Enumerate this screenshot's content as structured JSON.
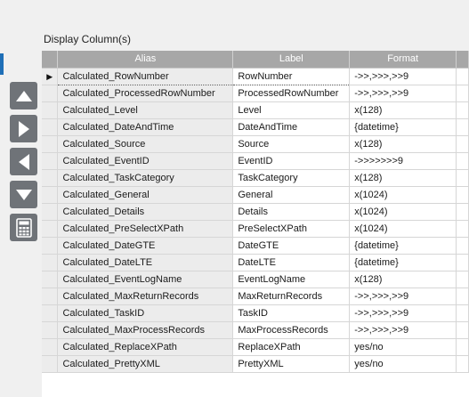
{
  "section": {
    "title": "Display Column(s)"
  },
  "toolbar": {
    "buttons": [
      {
        "name": "move-up-icon"
      },
      {
        "name": "move-right-icon"
      },
      {
        "name": "move-left-icon"
      },
      {
        "name": "move-down-icon"
      },
      {
        "name": "calculator-icon"
      }
    ]
  },
  "grid": {
    "headers": {
      "alias": "Alias",
      "label": "Label",
      "format": "Format"
    },
    "current_row_index": 0,
    "rows": [
      {
        "alias": "Calculated_RowNumber",
        "label": "RowNumber",
        "format": "->>,>>>,>>9"
      },
      {
        "alias": "Calculated_ProcessedRowNumber",
        "label": "ProcessedRowNumber",
        "format": "->>,>>>,>>9"
      },
      {
        "alias": "Calculated_Level",
        "label": "Level",
        "format": "x(128)"
      },
      {
        "alias": "Calculated_DateAndTime",
        "label": "DateAndTime",
        "format": "{datetime}"
      },
      {
        "alias": "Calculated_Source",
        "label": "Source",
        "format": "x(128)"
      },
      {
        "alias": "Calculated_EventID",
        "label": "EventID",
        "format": "->>>>>>>9"
      },
      {
        "alias": "Calculated_TaskCategory",
        "label": "TaskCategory",
        "format": "x(128)"
      },
      {
        "alias": "Calculated_General",
        "label": "General",
        "format": "x(1024)"
      },
      {
        "alias": "Calculated_Details",
        "label": "Details",
        "format": "x(1024)"
      },
      {
        "alias": "Calculated_PreSelectXPath",
        "label": "PreSelectXPath",
        "format": "x(1024)"
      },
      {
        "alias": "Calculated_DateGTE",
        "label": "DateGTE",
        "format": "{datetime}"
      },
      {
        "alias": "Calculated_DateLTE",
        "label": "DateLTE",
        "format": "{datetime}"
      },
      {
        "alias": "Calculated_EventLogName",
        "label": "EventLogName",
        "format": "x(128)"
      },
      {
        "alias": "Calculated_MaxReturnRecords",
        "label": "MaxReturnRecords",
        "format": "->>,>>>,>>9"
      },
      {
        "alias": "Calculated_TaskID",
        "label": "TaskID",
        "format": "->>,>>>,>>9"
      },
      {
        "alias": "Calculated_MaxProcessRecords",
        "label": "MaxProcessRecords",
        "format": "->>,>>>,>>9"
      },
      {
        "alias": "Calculated_ReplaceXPath",
        "label": "ReplaceXPath",
        "format": "yes/no"
      },
      {
        "alias": "Calculated_PrettyXML",
        "label": "PrettyXML",
        "format": "yes/no"
      }
    ]
  }
}
